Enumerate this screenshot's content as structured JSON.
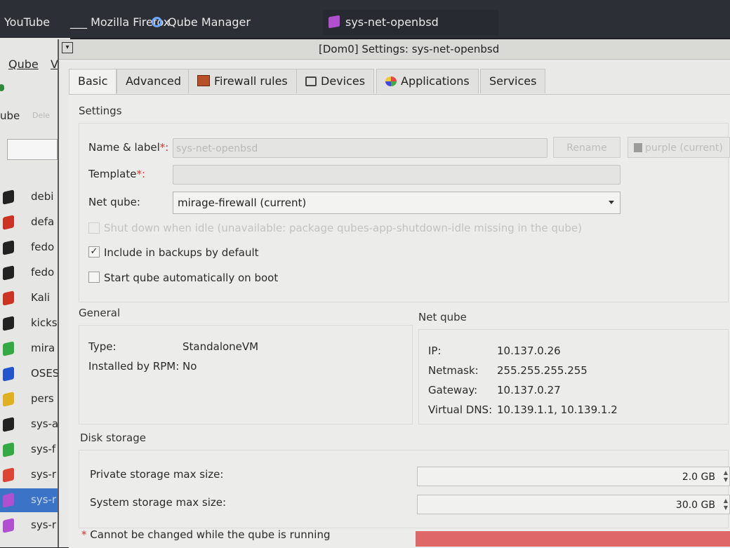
{
  "taskbar": {
    "items": [
      "YouTube",
      "___ Mozilla Firefox",
      "Qube Manager",
      "sys-net-openbsd"
    ]
  },
  "manager": {
    "menu": [
      "Qube",
      "V"
    ],
    "toolbar_label": "ube",
    "toolbar_disabled": "Dele",
    "vms": [
      {
        "name": "debi",
        "color": "#222222"
      },
      {
        "name": "defa",
        "color": "#cc3322"
      },
      {
        "name": "fedo",
        "color": "#222222"
      },
      {
        "name": "fedo",
        "color": "#222222"
      },
      {
        "name": "Kali",
        "color": "#cc3322"
      },
      {
        "name": "kicks",
        "color": "#222222"
      },
      {
        "name": "mira",
        "color": "#33aa44"
      },
      {
        "name": "OSES",
        "color": "#2255cc"
      },
      {
        "name": "pers",
        "color": "#e0b020"
      },
      {
        "name": "sys-a",
        "color": "#222222"
      },
      {
        "name": "sys-f",
        "color": "#33aa44"
      },
      {
        "name": "sys-r",
        "color": "#dd4433"
      },
      {
        "name": "sys-r",
        "color": "#b04fd0"
      },
      {
        "name": "sys-r",
        "color": "#b04fd0"
      }
    ],
    "selected_index": 12
  },
  "dialog": {
    "title": "[Dom0] Settings: sys-net-openbsd",
    "tabs": [
      "Basic",
      "Advanced",
      "Firewall rules",
      "Devices",
      "Applications",
      "Services"
    ],
    "settings_header": "Settings",
    "name_label": "Name & label",
    "name_value": "sys-net-openbsd",
    "rename_button": "Rename",
    "label_value": "purple (current)",
    "template_label": "Template",
    "netqube_label": "Net qube:",
    "netqube_value": "mirage-firewall (current)",
    "shutdown_idle": "Shut down when idle (unavailable: package qubes-app-shutdown-idle missing in the qube)",
    "include_backups": "Include in backups by default",
    "include_backups_checked": true,
    "start_on_boot": "Start qube automatically on boot",
    "start_on_boot_checked": false,
    "general_header": "General",
    "type_label": "Type:",
    "type_value": "StandaloneVM",
    "rpm_label": "Installed by RPM:",
    "rpm_value": "No",
    "netqube_header": "Net qube",
    "ip_label": "IP:",
    "ip_value": "10.137.0.26",
    "netmask_label": "Netmask:",
    "netmask_value": "255.255.255.255",
    "gateway_label": "Gateway:",
    "gateway_value": "10.137.0.27",
    "dns_label": "Virtual DNS:",
    "dns_value": "10.139.1.1, 10.139.1.2",
    "disk_header": "Disk storage",
    "private_label": "Private storage max size:",
    "private_value": "2.0 GB",
    "system_label": "System storage max size:",
    "system_value": "30.0 GB",
    "running_note": "Cannot be changed while the qube is running",
    "asterisk": "*",
    "required_mark": "*:"
  },
  "colors": {
    "accent": "#3b74c7",
    "error": "#e06767",
    "purple": "#b04fd0"
  }
}
